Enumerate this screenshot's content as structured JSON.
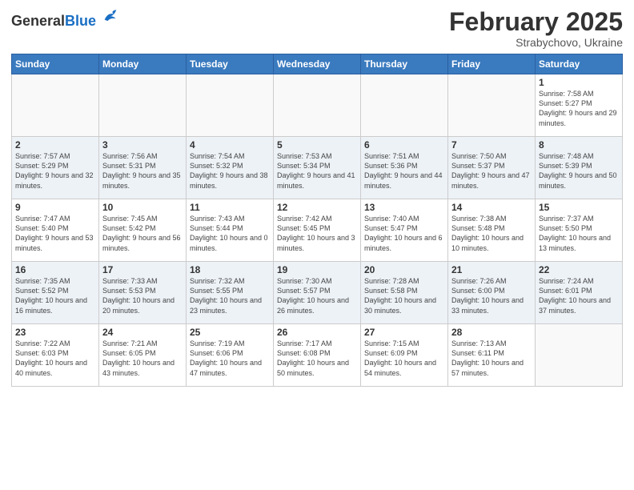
{
  "header": {
    "logo_general": "General",
    "logo_blue": "Blue",
    "month": "February 2025",
    "location": "Strabychovo, Ukraine"
  },
  "weekdays": [
    "Sunday",
    "Monday",
    "Tuesday",
    "Wednesday",
    "Thursday",
    "Friday",
    "Saturday"
  ],
  "weeks": [
    [
      {
        "day": "",
        "info": ""
      },
      {
        "day": "",
        "info": ""
      },
      {
        "day": "",
        "info": ""
      },
      {
        "day": "",
        "info": ""
      },
      {
        "day": "",
        "info": ""
      },
      {
        "day": "",
        "info": ""
      },
      {
        "day": "1",
        "info": "Sunrise: 7:58 AM\nSunset: 5:27 PM\nDaylight: 9 hours and 29 minutes."
      }
    ],
    [
      {
        "day": "2",
        "info": "Sunrise: 7:57 AM\nSunset: 5:29 PM\nDaylight: 9 hours and 32 minutes."
      },
      {
        "day": "3",
        "info": "Sunrise: 7:56 AM\nSunset: 5:31 PM\nDaylight: 9 hours and 35 minutes."
      },
      {
        "day": "4",
        "info": "Sunrise: 7:54 AM\nSunset: 5:32 PM\nDaylight: 9 hours and 38 minutes."
      },
      {
        "day": "5",
        "info": "Sunrise: 7:53 AM\nSunset: 5:34 PM\nDaylight: 9 hours and 41 minutes."
      },
      {
        "day": "6",
        "info": "Sunrise: 7:51 AM\nSunset: 5:36 PM\nDaylight: 9 hours and 44 minutes."
      },
      {
        "day": "7",
        "info": "Sunrise: 7:50 AM\nSunset: 5:37 PM\nDaylight: 9 hours and 47 minutes."
      },
      {
        "day": "8",
        "info": "Sunrise: 7:48 AM\nSunset: 5:39 PM\nDaylight: 9 hours and 50 minutes."
      }
    ],
    [
      {
        "day": "9",
        "info": "Sunrise: 7:47 AM\nSunset: 5:40 PM\nDaylight: 9 hours and 53 minutes."
      },
      {
        "day": "10",
        "info": "Sunrise: 7:45 AM\nSunset: 5:42 PM\nDaylight: 9 hours and 56 minutes."
      },
      {
        "day": "11",
        "info": "Sunrise: 7:43 AM\nSunset: 5:44 PM\nDaylight: 10 hours and 0 minutes."
      },
      {
        "day": "12",
        "info": "Sunrise: 7:42 AM\nSunset: 5:45 PM\nDaylight: 10 hours and 3 minutes."
      },
      {
        "day": "13",
        "info": "Sunrise: 7:40 AM\nSunset: 5:47 PM\nDaylight: 10 hours and 6 minutes."
      },
      {
        "day": "14",
        "info": "Sunrise: 7:38 AM\nSunset: 5:48 PM\nDaylight: 10 hours and 10 minutes."
      },
      {
        "day": "15",
        "info": "Sunrise: 7:37 AM\nSunset: 5:50 PM\nDaylight: 10 hours and 13 minutes."
      }
    ],
    [
      {
        "day": "16",
        "info": "Sunrise: 7:35 AM\nSunset: 5:52 PM\nDaylight: 10 hours and 16 minutes."
      },
      {
        "day": "17",
        "info": "Sunrise: 7:33 AM\nSunset: 5:53 PM\nDaylight: 10 hours and 20 minutes."
      },
      {
        "day": "18",
        "info": "Sunrise: 7:32 AM\nSunset: 5:55 PM\nDaylight: 10 hours and 23 minutes."
      },
      {
        "day": "19",
        "info": "Sunrise: 7:30 AM\nSunset: 5:57 PM\nDaylight: 10 hours and 26 minutes."
      },
      {
        "day": "20",
        "info": "Sunrise: 7:28 AM\nSunset: 5:58 PM\nDaylight: 10 hours and 30 minutes."
      },
      {
        "day": "21",
        "info": "Sunrise: 7:26 AM\nSunset: 6:00 PM\nDaylight: 10 hours and 33 minutes."
      },
      {
        "day": "22",
        "info": "Sunrise: 7:24 AM\nSunset: 6:01 PM\nDaylight: 10 hours and 37 minutes."
      }
    ],
    [
      {
        "day": "23",
        "info": "Sunrise: 7:22 AM\nSunset: 6:03 PM\nDaylight: 10 hours and 40 minutes."
      },
      {
        "day": "24",
        "info": "Sunrise: 7:21 AM\nSunset: 6:05 PM\nDaylight: 10 hours and 43 minutes."
      },
      {
        "day": "25",
        "info": "Sunrise: 7:19 AM\nSunset: 6:06 PM\nDaylight: 10 hours and 47 minutes."
      },
      {
        "day": "26",
        "info": "Sunrise: 7:17 AM\nSunset: 6:08 PM\nDaylight: 10 hours and 50 minutes."
      },
      {
        "day": "27",
        "info": "Sunrise: 7:15 AM\nSunset: 6:09 PM\nDaylight: 10 hours and 54 minutes."
      },
      {
        "day": "28",
        "info": "Sunrise: 7:13 AM\nSunset: 6:11 PM\nDaylight: 10 hours and 57 minutes."
      },
      {
        "day": "",
        "info": ""
      }
    ]
  ]
}
